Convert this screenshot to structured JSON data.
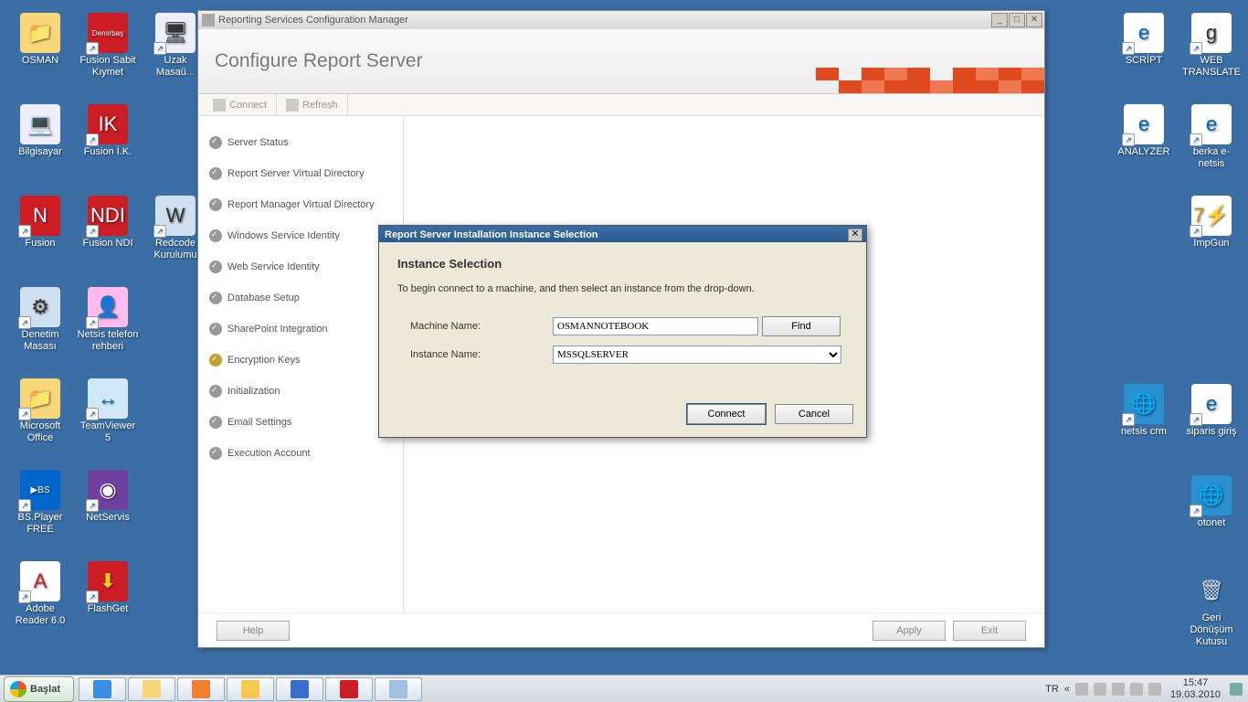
{
  "desktop_left": [
    {
      "label": "OSMAN",
      "glyph": "📁",
      "bg": "#f8d77a",
      "shortcut": false
    },
    {
      "label": "Fusion Sabit Kıymet",
      "glyph": "Demirbaş",
      "bg": "#cc1c24",
      "txt": "#fff",
      "shortcut": true,
      "fs": "8px"
    },
    {
      "label": "Uzak Masaü...",
      "glyph": "🖥",
      "bg": "#eef",
      "shortcut": true
    },
    {
      "label": "Bilgisayar",
      "glyph": "💻",
      "bg": "#eef",
      "shortcut": false
    },
    {
      "label": "Fusion İ.K.",
      "glyph": "IK",
      "bg": "#cc1c24",
      "txt": "#fff",
      "shortcut": true
    },
    {
      "label": "",
      "glyph": "",
      "bg": "transparent",
      "shortcut": false
    },
    {
      "label": "Fusion",
      "glyph": "N",
      "bg": "#cc1c24",
      "txt": "#fff",
      "shortcut": true
    },
    {
      "label": "Fusion NDI",
      "glyph": "NDI",
      "bg": "#cc1c24",
      "txt": "#fff",
      "shortcut": true
    },
    {
      "label": "Redcode Kurulumu",
      "glyph": "W",
      "bg": "#d0e0f0",
      "shortcut": true
    },
    {
      "label": "Denetim Masası",
      "glyph": "⚙",
      "bg": "#d0e0f0",
      "shortcut": true
    },
    {
      "label": "Netsis telefon rehberi",
      "glyph": "👤",
      "bg": "#fbe",
      "shortcut": true
    },
    {
      "label": "",
      "glyph": "",
      "bg": "transparent",
      "shortcut": false
    },
    {
      "label": "Microsoft Office",
      "glyph": "📁",
      "bg": "#f8d77a",
      "shortcut": true
    },
    {
      "label": "TeamViewer 5",
      "glyph": "↔",
      "bg": "#d0e8f8",
      "txt": "#0066cc",
      "shortcut": true
    },
    {
      "label": "",
      "glyph": "",
      "bg": "transparent",
      "shortcut": false
    },
    {
      "label": "BS.Player FREE",
      "glyph": "▶BS",
      "bg": "#0066cc",
      "txt": "#fff",
      "shortcut": true,
      "fs": "10px"
    },
    {
      "label": "NetServis",
      "glyph": "◉",
      "bg": "#7040a0",
      "txt": "#fff",
      "shortcut": true
    },
    {
      "label": "",
      "glyph": "",
      "bg": "transparent",
      "shortcut": false
    },
    {
      "label": "Adobe Reader 6.0",
      "glyph": "A",
      "bg": "#fff",
      "txt": "#cc1c24",
      "shortcut": true
    },
    {
      "label": "FlashGet",
      "glyph": "⬇",
      "bg": "#cc1c24",
      "txt": "#ffcc00",
      "shortcut": true
    }
  ],
  "desktop_right": [
    {
      "label": "SCRİPT",
      "glyph": "e",
      "bg": "#fff",
      "txt": "#0066cc",
      "shortcut": true
    },
    {
      "label": "WEB TRANSLATE",
      "glyph": "g",
      "bg": "#fff",
      "shortcut": true
    },
    {
      "label": "ANALYZER",
      "glyph": "e",
      "bg": "#fff",
      "txt": "#0066cc",
      "shortcut": true
    },
    {
      "label": "berka e-netsis",
      "glyph": "e",
      "bg": "#fff",
      "txt": "#0066cc",
      "shortcut": true
    },
    {
      "label": "",
      "glyph": "",
      "bg": "transparent"
    },
    {
      "label": "ImpGun",
      "glyph": "7⚡",
      "bg": "#fff",
      "txt": "#c90",
      "shortcut": true
    },
    {
      "label": "netsis crm",
      "glyph": "🌐",
      "bg": "#2a90d0",
      "shortcut": true
    },
    {
      "label": "siparis giriş",
      "glyph": "e",
      "bg": "#fff",
      "txt": "#0066cc",
      "shortcut": true
    },
    {
      "label": "",
      "glyph": "",
      "bg": "transparent"
    },
    {
      "label": "otonet",
      "glyph": "🌐",
      "bg": "#2a90d0",
      "shortcut": true
    },
    {
      "label": "",
      "glyph": "",
      "bg": "transparent"
    },
    {
      "label": "Geri Dönüşüm Kutusu",
      "glyph": "🗑",
      "bg": "transparent",
      "txt": "#cde"
    }
  ],
  "cfg": {
    "title": "Reporting Services Configuration Manager",
    "heading": "Configure Report Server",
    "toolbar": {
      "connect": "Connect",
      "refresh": "Refresh"
    },
    "nav": [
      {
        "label": "Server Status"
      },
      {
        "label": "Report Server Virtual Directory"
      },
      {
        "label": "Report Manager Virtual Directory"
      },
      {
        "label": "Windows Service Identity"
      },
      {
        "label": "Web Service Identity"
      },
      {
        "label": "Database Setup"
      },
      {
        "label": "SharePoint Integration"
      },
      {
        "label": "Encryption Keys",
        "warn": true
      },
      {
        "label": "Initialization"
      },
      {
        "label": "Email Settings"
      },
      {
        "label": "Execution Account"
      }
    ],
    "footer": {
      "help": "Help",
      "apply": "Apply",
      "exit": "Exit"
    }
  },
  "dialog": {
    "title": "Report Server Installation Instance Selection",
    "heading": "Instance Selection",
    "hint": "To begin connect to a machine, and then select an instance from the drop-down.",
    "machine_label": "Machine Name:",
    "machine_value": "OSMANNOTEBOOK",
    "find": "Find",
    "instance_label": "Instance Name:",
    "instance_value": "MSSQLSERVER",
    "connect": "Connect",
    "cancel": "Cancel"
  },
  "taskbar": {
    "start": "Başlat",
    "lang": "TR",
    "time": "15:47",
    "date": "19.03.2010"
  }
}
